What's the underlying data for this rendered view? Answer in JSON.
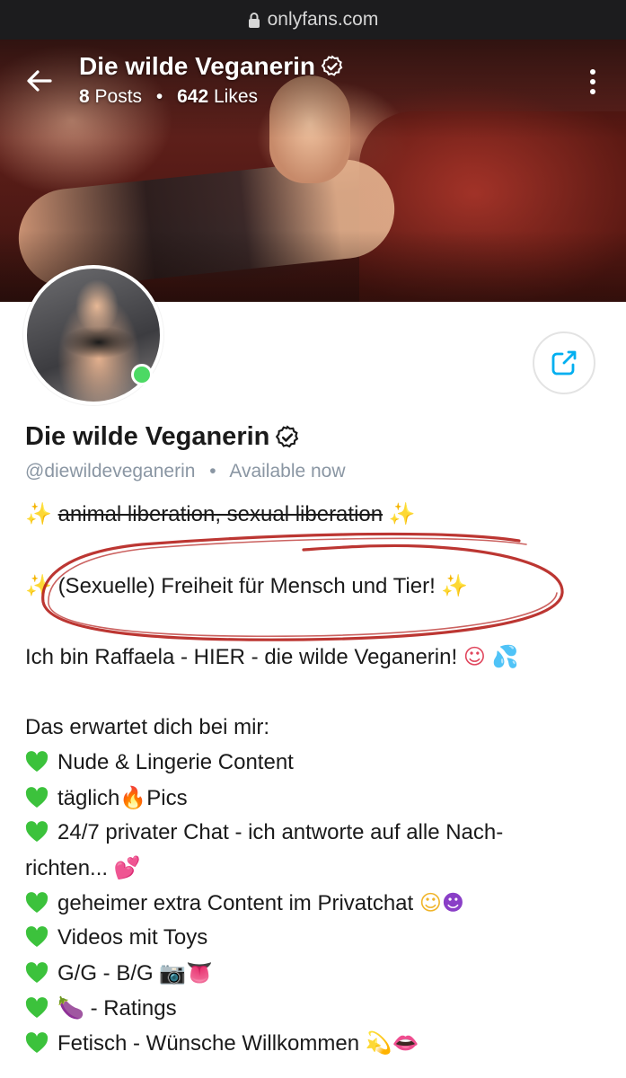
{
  "browser": {
    "domain": "onlyfans.com"
  },
  "header": {
    "title": "Die wilde Veganerin",
    "posts_count": "8",
    "posts_label": "Posts",
    "likes_count": "642",
    "likes_label": "Likes"
  },
  "profile": {
    "name": "Die wilde Veganerin",
    "handle": "@diewildeveganerin",
    "status": "Available now",
    "online": true
  },
  "bio": {
    "line1": "animal liberation, sexual liberation",
    "line2": "(Sexuelle) Freiheit für Mensch und Tier!",
    "line3": "Ich bin Raffaela - HIER - die wilde Veganerin!",
    "line4": "Das erwartet dich bei mir:",
    "items": [
      "Nude & Lingerie Content",
      "täglich",
      "Pics",
      "24/7 privater Chat - ich antworte auf alle Nach-",
      "richten...",
      "geheimer extra Content im Privatchat",
      "Videos mit Toys",
      "G/G - B/G",
      "- Ratings",
      "Fetisch - Wünsche Willkommen"
    ]
  },
  "colors": {
    "accent": "#00aff0",
    "verified": "#1a1a1a",
    "online": "#4cd964",
    "heart": "#3cc23c",
    "annotation": "#b5201c",
    "muted": "#8a96a3"
  },
  "icons": {
    "back": "arrow-left-icon",
    "more": "more-vertical-icon",
    "share": "share-icon",
    "verified": "verified-check-icon",
    "lock": "lock-icon"
  }
}
